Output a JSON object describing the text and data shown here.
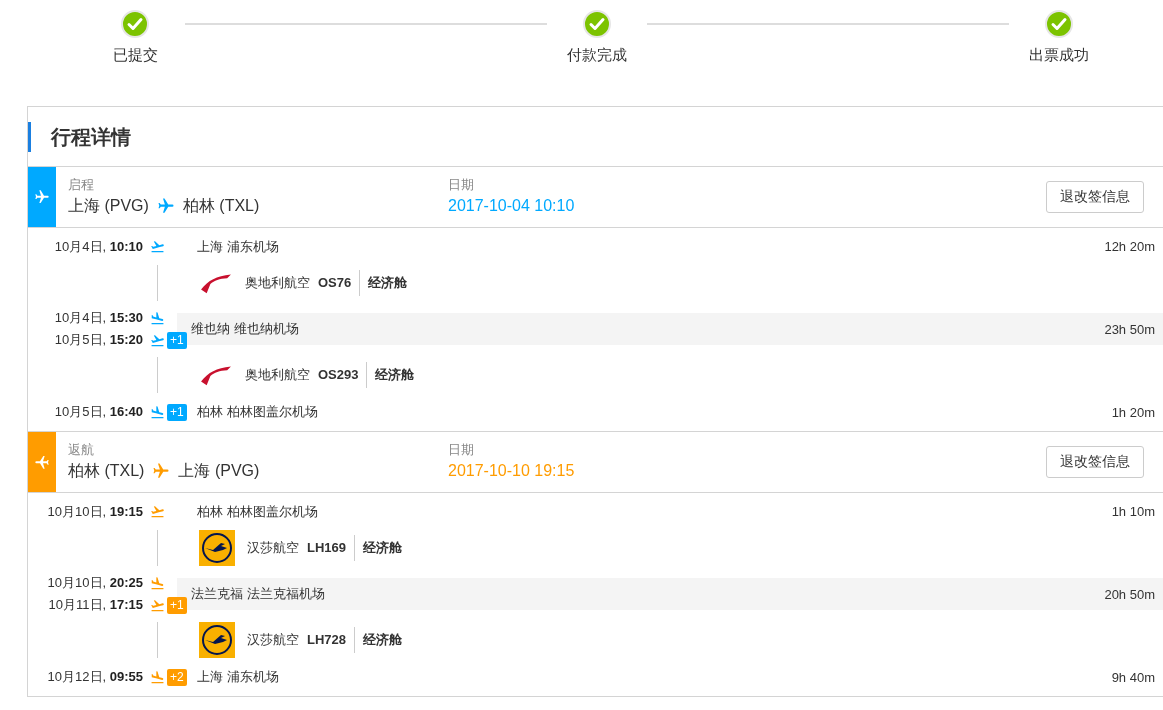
{
  "steps": [
    {
      "label": "已提交",
      "completed": true
    },
    {
      "label": "付款完成",
      "completed": true
    },
    {
      "label": "出票成功",
      "completed": true
    }
  ],
  "card": {
    "title": "行程详情",
    "legs": [
      {
        "kind": "outbound",
        "color": "#00a9ff",
        "label": "启程",
        "from": "上海 (PVG)",
        "to": "柏林 (TXL)",
        "date_label": "日期",
        "date": "2017-10-04 10:10",
        "button": "退改签信息",
        "rows": [
          {
            "kind": "depart",
            "when": "10月4日, **10:10**",
            "airport": "上海 浦东机场",
            "duration": "12h 20m"
          },
          {
            "kind": "flight",
            "logo": {
              "kind": "swoosh"
            },
            "airline": "奥地利航空",
            "flight_no": "OS76",
            "cabin": "经济舱"
          },
          {
            "kind": "transfer",
            "arrive_when": "10月4日, **15:30**",
            "depart_when": "10月5日, **15:20**",
            "depart_badge": "+1",
            "airport": "维也纳 维也纳机场",
            "duration": "23h 50m"
          },
          {
            "kind": "flight",
            "logo": {
              "kind": "swoosh"
            },
            "airline": "奥地利航空",
            "flight_no": "OS293",
            "cabin": "经济舱"
          },
          {
            "kind": "arrive",
            "when": "10月5日, **16:40**",
            "badge": "+1",
            "airport": "柏林 柏林图盖尔机场",
            "duration": "1h 20m"
          }
        ]
      },
      {
        "kind": "return",
        "color": "#ff9c00",
        "label": "返航",
        "from": "柏林 (TXL)",
        "to": "上海 (PVG)",
        "date_label": "日期",
        "date": "2017-10-10 19:15",
        "button": "退改签信息",
        "rows": [
          {
            "kind": "depart",
            "when": "10月10日, **19:15**",
            "airport": "柏林 柏林图盖尔机场",
            "duration": "1h 10m"
          },
          {
            "kind": "flight",
            "logo": {
              "kind": "crane"
            },
            "airline": "汉莎航空",
            "flight_no": "LH169",
            "cabin": "经济舱"
          },
          {
            "kind": "transfer",
            "arrive_when": "10月10日, **20:25**",
            "depart_when": "10月11日, **17:15**",
            "depart_badge": "+1",
            "airport": "法兰克福 法兰克福机场",
            "duration": "20h 50m"
          },
          {
            "kind": "flight",
            "logo": {
              "kind": "crane"
            },
            "airline": "汉莎航空",
            "flight_no": "LH728",
            "cabin": "经济舱"
          },
          {
            "kind": "arrive",
            "when": "10月12日, **09:55**",
            "badge": "+2",
            "airport": "上海 浦东机场",
            "duration": "9h 40m"
          }
        ]
      }
    ]
  }
}
